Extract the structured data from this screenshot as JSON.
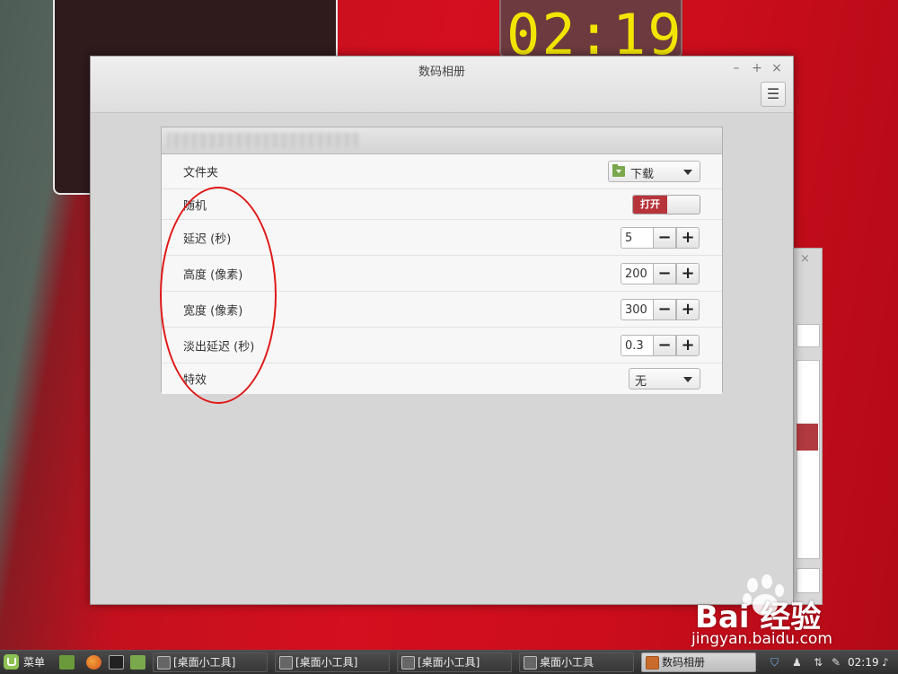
{
  "window": {
    "title": "数码相册"
  },
  "titlebar_controls": {
    "minimize": "–",
    "maximize": "+",
    "close": "×",
    "menu": "☰"
  },
  "clock_widget": {
    "time": "02:19"
  },
  "settings": {
    "folder": {
      "label": "文件夹",
      "value": "下载"
    },
    "random": {
      "label": "随机",
      "toggle_text": "打开"
    },
    "delay": {
      "label": "延迟 (秒)",
      "value": "5"
    },
    "height": {
      "label": "高度 (像素)",
      "value": "200"
    },
    "width": {
      "label": "宽度 (像素)",
      "value": "300"
    },
    "fade_delay": {
      "label": "淡出延迟 (秒)",
      "value": "0.3"
    },
    "effect": {
      "label": "特效",
      "value": "无"
    }
  },
  "spin": {
    "minus": "−",
    "plus": "+"
  },
  "taskbar": {
    "menu_label": "菜单",
    "tasks": [
      "[桌面小工具]",
      "[桌面小工具]",
      "[桌面小工具]",
      "桌面小工具",
      "数码相册"
    ],
    "clock": "02:19"
  },
  "watermark": {
    "brand": "Bai 经验",
    "url": "jingyan.baidu.com"
  },
  "colors": {
    "accent_red": "#b8343b",
    "annotation": "#e01818",
    "clock_digits": "#f2e600"
  }
}
